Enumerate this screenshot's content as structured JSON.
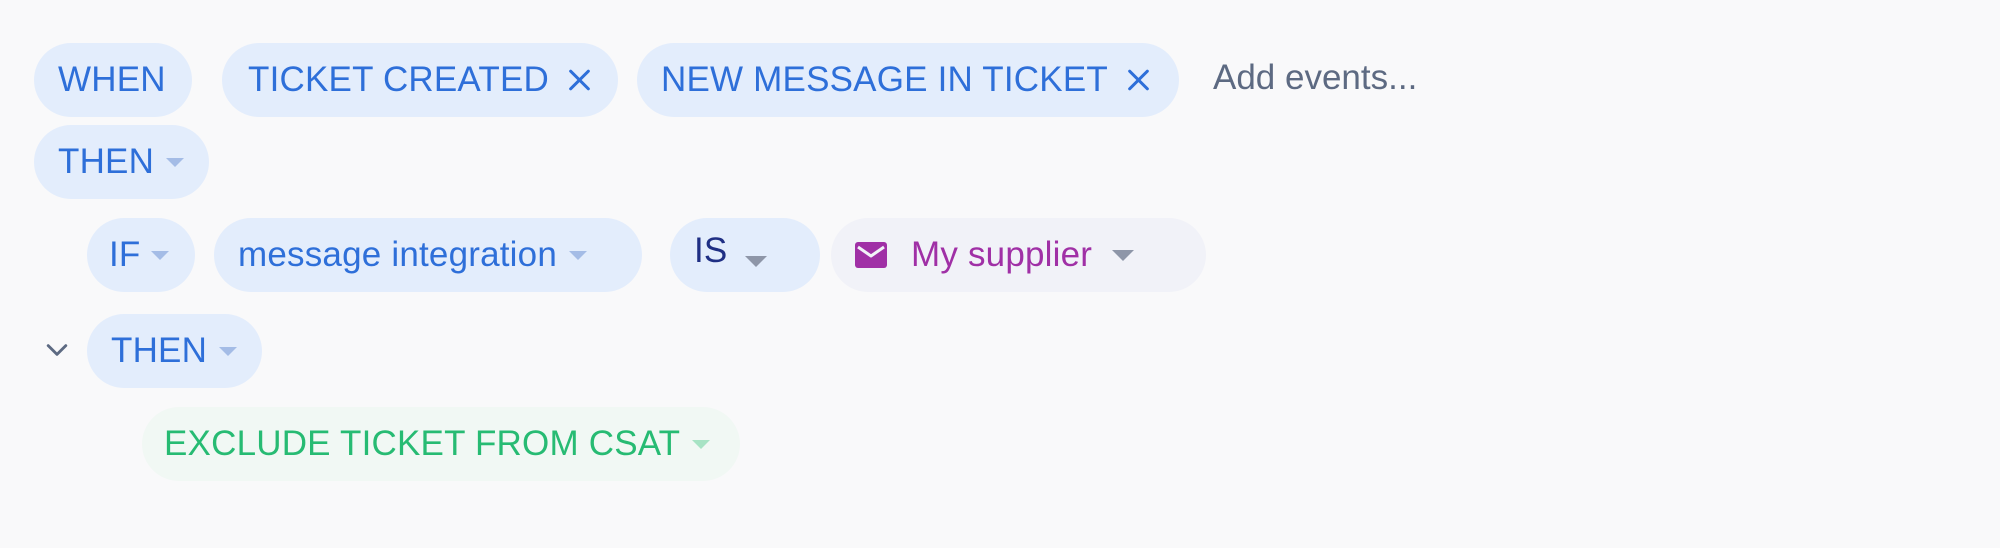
{
  "when_label": "WHEN",
  "events": [
    {
      "label": "TICKET CREATED"
    },
    {
      "label": "NEW MESSAGE IN TICKET"
    }
  ],
  "add_events_placeholder": "Add events...",
  "then_top_label": "THEN",
  "condition": {
    "if_label": "IF",
    "field_label": "message integration",
    "operator_label": "IS",
    "value_label": "My supplier",
    "value_icon": "mail-icon"
  },
  "then_inner_label": "THEN",
  "action_label": "EXCLUDE TICKET FROM CSAT",
  "colors": {
    "accent_blue": "#2e6fd9",
    "pill_blue_bg": "#e3edfc",
    "operator_text": "#1f2f84",
    "value_purple": "#a030a6",
    "action_green": "#27bb73"
  }
}
